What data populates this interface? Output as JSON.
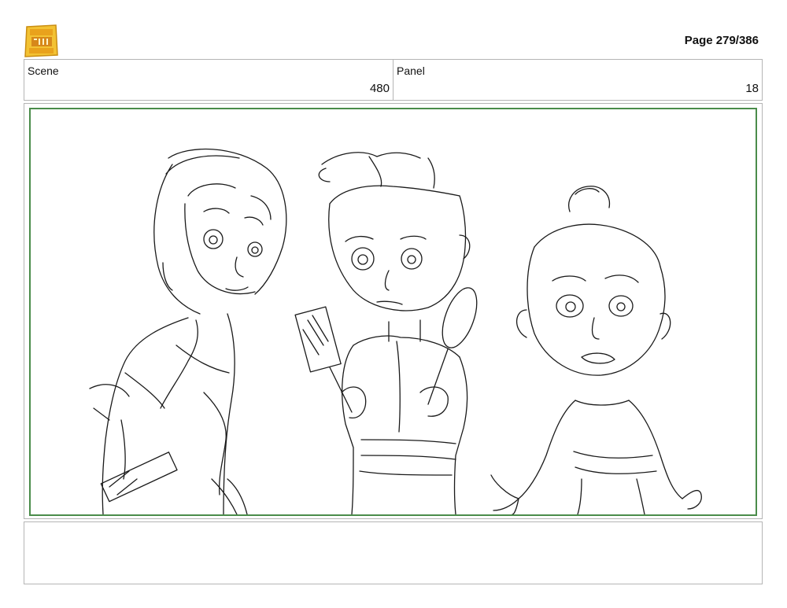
{
  "header": {
    "logo_text": "YOUNG JEDI ADVENTURES",
    "page_label": "Page 279/386"
  },
  "info": {
    "scene_label": "Scene",
    "scene_value": "480",
    "panel_label": "Panel",
    "panel_value": "18"
  },
  "panel": {
    "border_color": "#4a8c4a",
    "content": "storyboard-sketch"
  },
  "notes": {
    "text": ""
  }
}
